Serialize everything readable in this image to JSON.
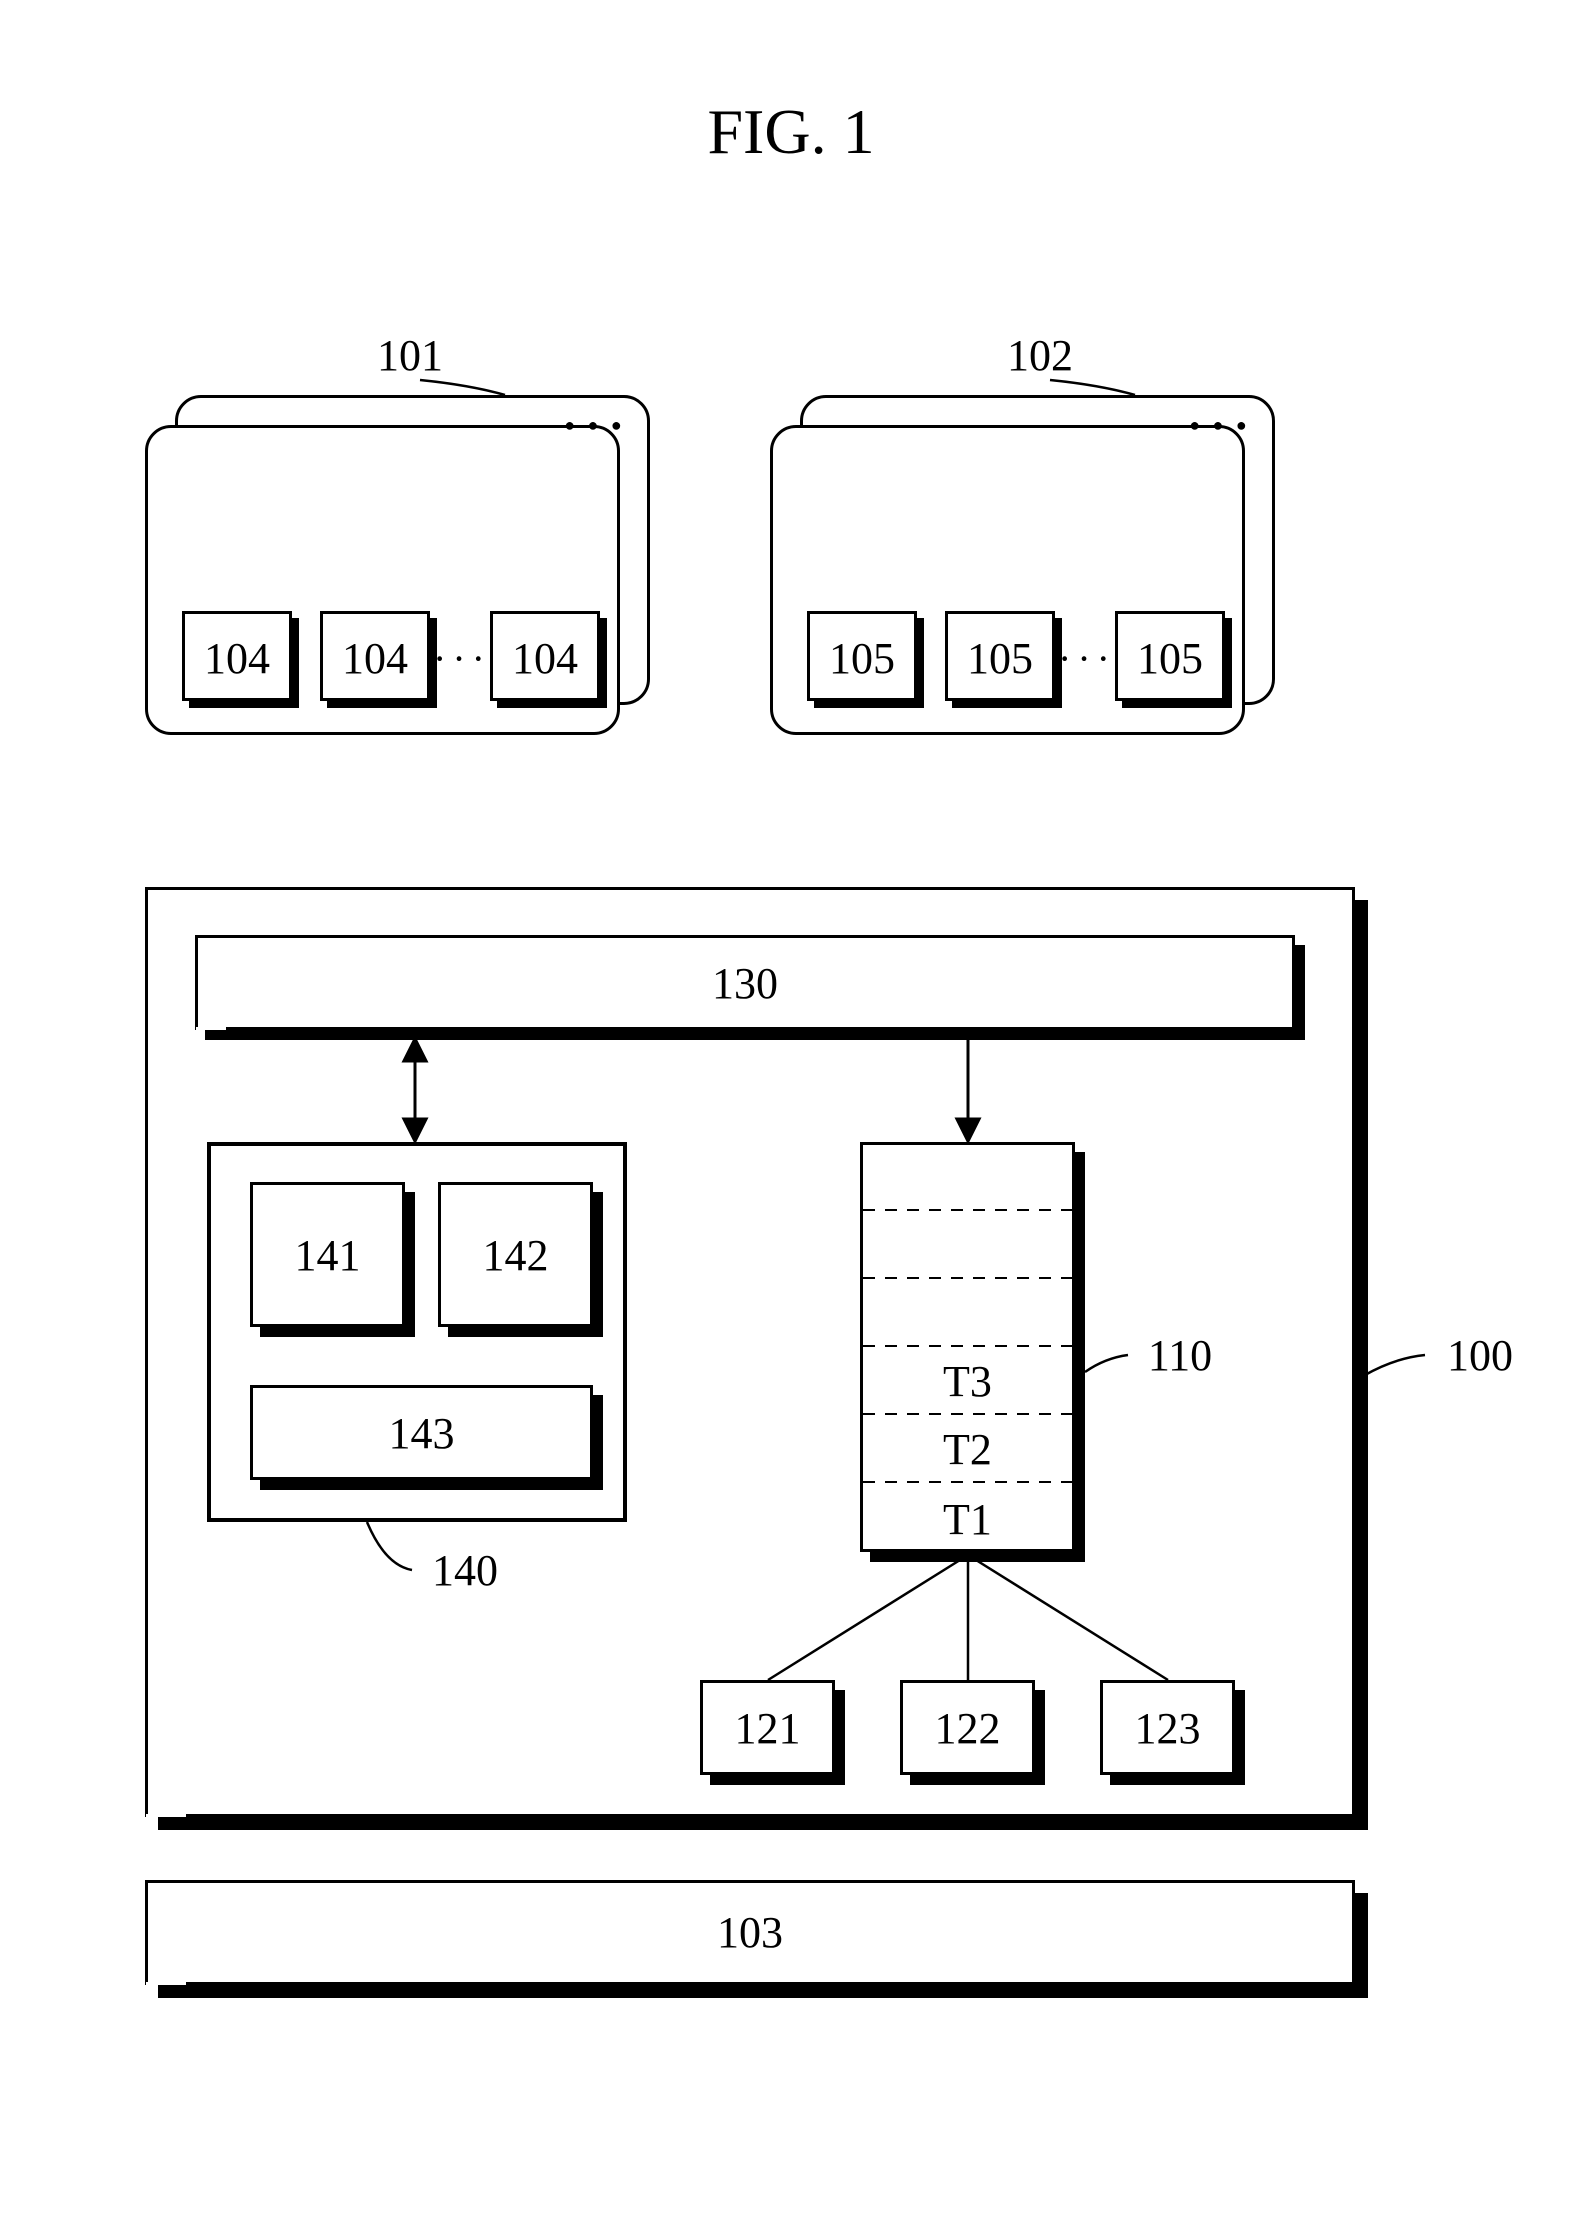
{
  "title": "FIG. 1",
  "topLeft": {
    "callout": "101",
    "boxes": [
      "104",
      "104",
      "104"
    ]
  },
  "topRight": {
    "callout": "102",
    "boxes": [
      "105",
      "105",
      "105"
    ]
  },
  "main": {
    "callout": "100",
    "topBar": "130",
    "leftGroup": {
      "callout": "140",
      "b1": "141",
      "b2": "142",
      "b3": "143"
    },
    "stack": {
      "callout": "110",
      "t3": "T3",
      "t2": "T2",
      "t1": "T1"
    },
    "children": {
      "c1": "121",
      "c2": "122",
      "c3": "123"
    }
  },
  "bottomBar": "103"
}
